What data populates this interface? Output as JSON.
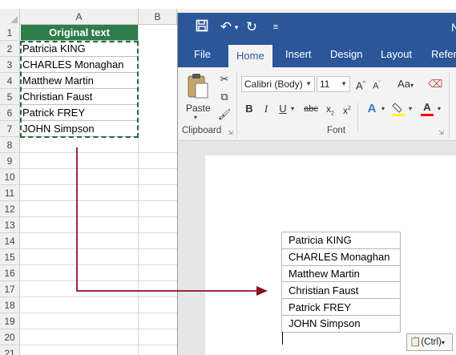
{
  "excel": {
    "columns": [
      "A",
      "B"
    ],
    "rows": [
      "1",
      "2",
      "3",
      "4",
      "5",
      "6",
      "7",
      "8",
      "9",
      "10",
      "11",
      "12",
      "13",
      "14",
      "15",
      "16",
      "17",
      "18",
      "19",
      "20",
      "21"
    ],
    "header_text": "Original text",
    "names": [
      "Patricia KING",
      "CHARLES Monaghan",
      "Matthew Martin",
      "Christian Faust",
      "Patrick FREY",
      "JOHN Simpson"
    ]
  },
  "word": {
    "title_partial": "N",
    "tabs": [
      "File",
      "Home",
      "Insert",
      "Design",
      "Layout",
      "Refere"
    ],
    "active_tab": "Home",
    "clipboard": {
      "paste_label": "Paste",
      "group_label": "Clipboard"
    },
    "font": {
      "name": "Calibri (Body)",
      "size": "11",
      "group_label": "Font"
    },
    "table": [
      "Patricia KING",
      "CHARLES Monaghan",
      "Matthew Martin",
      "Christian Faust",
      "Patrick FREY",
      "JOHN Simpson"
    ],
    "paste_options_label": "(Ctrl)"
  },
  "colors": {
    "excel_header_bg": "#2e7d4a",
    "word_blue": "#2b579a",
    "arrow": "#8b0e24"
  }
}
